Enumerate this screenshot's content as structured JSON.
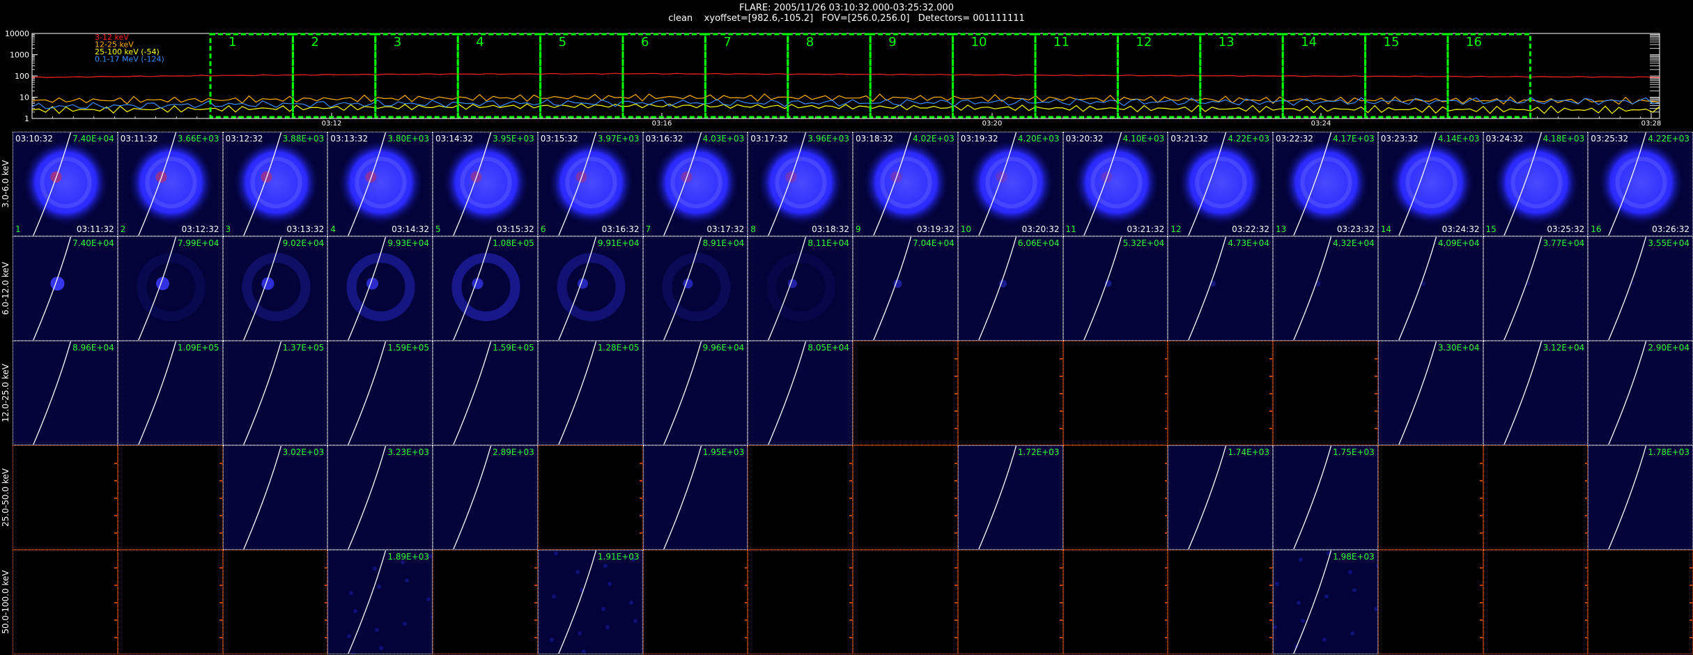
{
  "header": {
    "line1": "FLARE: 2005/11/26 03:10:32.000-03:25:32.000",
    "line2": "clean    xyoffset=[982.6,-105.2]   FOV=[256.0,256.0]   Detectors= 001111111"
  },
  "colors": {
    "box": "#00ff00",
    "empty_border": "#ff5a00",
    "image_border": "#e0e0e0",
    "limb": "#ffffff",
    "value_text": "#33ff33"
  },
  "lightcurve": {
    "y_ticks": [
      "10000",
      "1000",
      "100",
      "10",
      "1"
    ],
    "x_ticks": [
      "03:12",
      "03:16",
      "03:20",
      "03:24",
      "03:28"
    ],
    "legend": [
      {
        "label": "3-12 keV",
        "color": "#ff2020"
      },
      {
        "label": "12-25 keV",
        "color": "#ffb000"
      },
      {
        "label": "25-100 keV (-54)",
        "color": "#ffff00"
      },
      {
        "label": "0.1-17 MeV (-124)",
        "color": "#3a8cff"
      }
    ],
    "box_numbers": [
      "1",
      "2",
      "3",
      "4",
      "5",
      "6",
      "7",
      "8",
      "9",
      "10",
      "11",
      "12",
      "13",
      "14",
      "15",
      "16"
    ]
  },
  "chart_data": {
    "type": "line",
    "title": "",
    "xlabel": "",
    "ylabel": "",
    "yscale": "log",
    "ylim": [
      1,
      10000
    ],
    "x_range_minutes": [
      3.18,
      18.75
    ],
    "grid": false,
    "legend_position": "top-left",
    "series": [
      {
        "name": "3-12 keV",
        "x": [
          3.2,
          5,
          7,
          9,
          11,
          13,
          15,
          17,
          18.7
        ],
        "values": [
          85,
          105,
          122,
          128,
          120,
          108,
          100,
          93,
          88
        ]
      },
      {
        "name": "12-25 keV",
        "x": [
          3.2,
          5,
          7,
          9,
          11,
          13,
          15,
          17,
          18.7
        ],
        "values": [
          7,
          7.5,
          9,
          10,
          9.5,
          8.5,
          7.5,
          7,
          6.5
        ]
      },
      {
        "name": "25-100 keV (-54)",
        "x": [
          3.2,
          5,
          7,
          9,
          11,
          13,
          15,
          17,
          18.7
        ],
        "values": [
          2.5,
          2.8,
          3.5,
          4,
          3.5,
          3,
          2.8,
          2.6,
          2.5
        ]
      },
      {
        "name": "0.1-17 MeV (-124)",
        "x": [
          3.2,
          5,
          7,
          9,
          11,
          13,
          15,
          17,
          18.7
        ],
        "values": [
          3.5,
          4.5,
          5,
          5.5,
          5.5,
          6,
          6,
          6.5,
          6.5
        ]
      }
    ]
  },
  "energy_bands": [
    "3.0-6.0 keV",
    "6.0-12.0 keV",
    "12.0-25.0 keV",
    "25.0-50.0 keV",
    "50.0-100.0 keV"
  ],
  "time_starts": [
    "03:10:32",
    "03:11:32",
    "03:12:32",
    "03:13:32",
    "03:14:32",
    "03:15:32",
    "03:16:32",
    "03:17:32",
    "03:18:32",
    "03:19:32",
    "03:20:32",
    "03:21:32",
    "03:22:32",
    "03:23:32",
    "03:24:32",
    "03:25:32"
  ],
  "time_ends": [
    "03:11:32",
    "03:12:32",
    "03:13:32",
    "03:14:32",
    "03:15:32",
    "03:16:32",
    "03:17:32",
    "03:18:32",
    "03:19:32",
    "03:20:32",
    "03:21:32",
    "03:22:32",
    "03:23:32",
    "03:24:32",
    "03:25:32",
    "03:26:32"
  ],
  "image_values": [
    [
      "7.40E+04",
      "3.66E+03",
      "3.88E+03",
      "3.80E+03",
      "3.95E+03",
      "3.97E+03",
      "4.03E+03",
      "3.96E+03",
      "4.02E+03",
      "4.20E+03",
      "4.10E+03",
      "4.22E+03",
      "4.17E+03",
      "4.14E+03",
      "4.18E+03",
      "4.22E+03"
    ],
    [
      "7.40E+04",
      "7.99E+04",
      "9.02E+04",
      "9.93E+04",
      "1.08E+05",
      "9.91E+04",
      "8.91E+04",
      "8.11E+04",
      "7.04E+04",
      "6.06E+04",
      "5.32E+04",
      "4.73E+04",
      "4.32E+04",
      "4.09E+04",
      "3.77E+04",
      "3.55E+04"
    ],
    [
      "8.96E+04",
      "1.09E+05",
      "1.37E+05",
      "1.59E+05",
      "1.59E+05",
      "1.28E+05",
      "9.96E+04",
      "8.05E+04",
      "",
      "",
      "",
      "",
      "",
      "3.30E+04",
      "3.12E+04",
      "2.90E+04"
    ],
    [
      "",
      "",
      "3.02E+03",
      "3.23E+03",
      "2.89E+03",
      "",
      "1.95E+03",
      "",
      "",
      "1.72E+03",
      "",
      "1.74E+03",
      "1.75E+03",
      "",
      "",
      "1.78E+03"
    ],
    [
      "",
      "",
      "",
      "1.89E+03",
      "",
      "1.91E+03",
      "",
      "",
      "",
      "",
      "",
      "",
      "1.98E+03",
      "",
      "",
      ""
    ]
  ]
}
